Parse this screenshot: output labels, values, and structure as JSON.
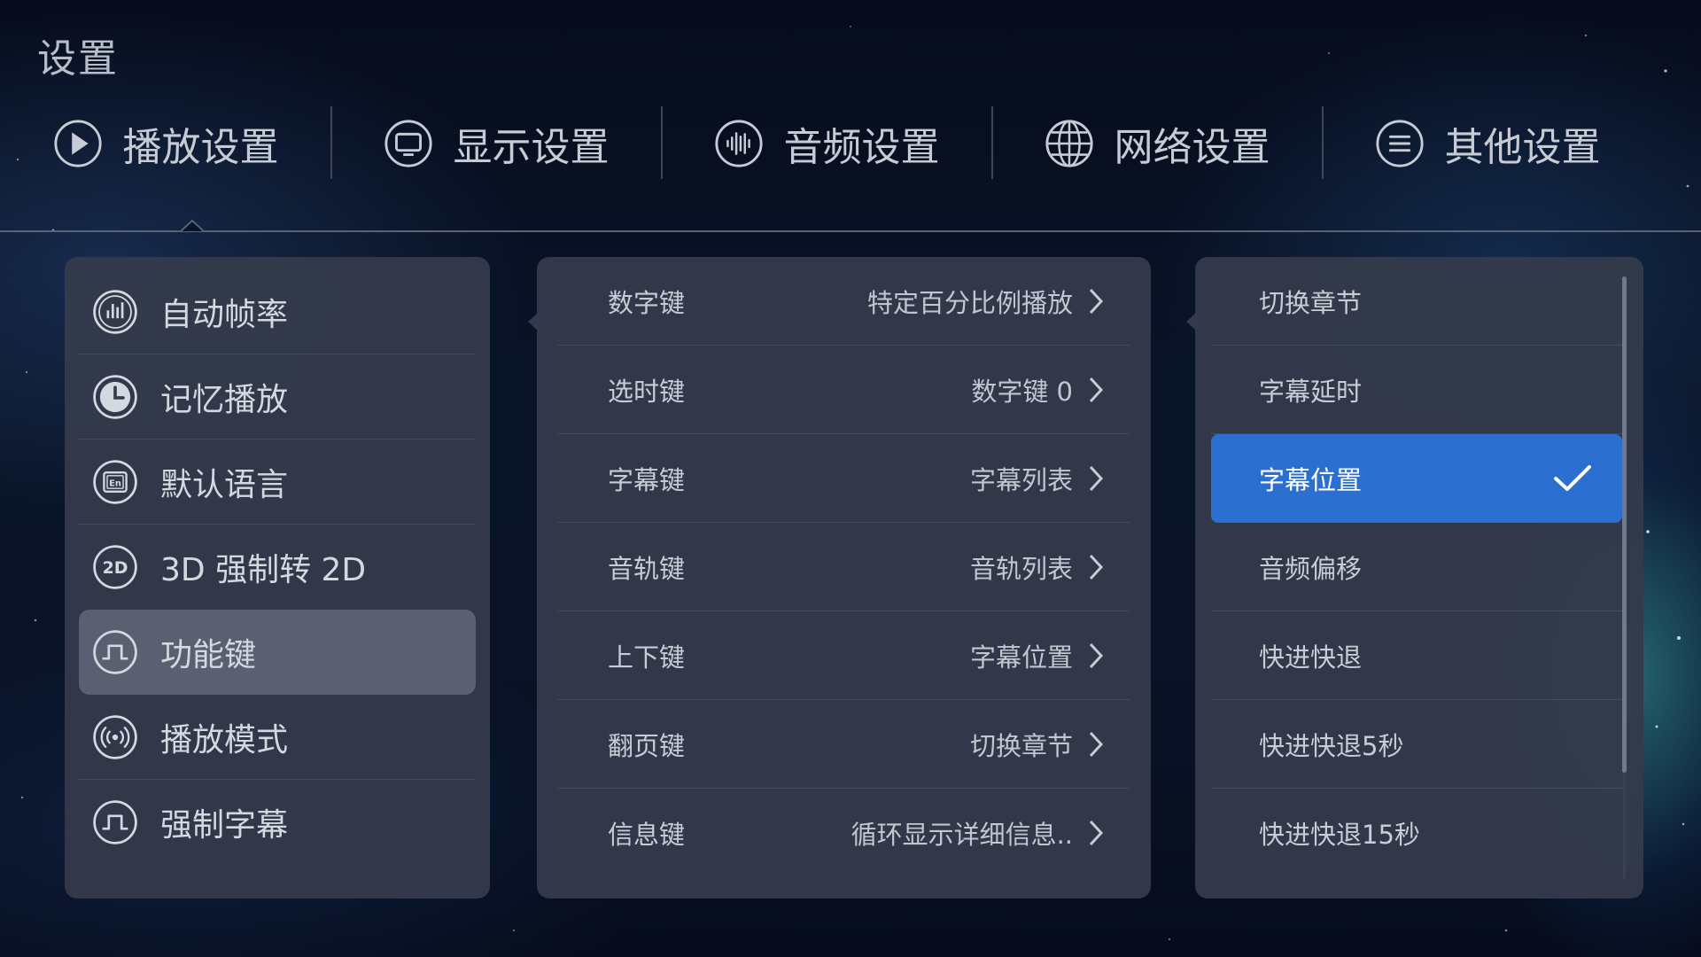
{
  "page": {
    "title": "设置"
  },
  "tabs": [
    {
      "label": "播放设置",
      "icon": "play-icon"
    },
    {
      "label": "显示设置",
      "icon": "monitor-icon"
    },
    {
      "label": "音频设置",
      "icon": "audio-wave-icon"
    },
    {
      "label": "网络设置",
      "icon": "globe-icon"
    },
    {
      "label": "其他设置",
      "icon": "menu-lines-icon"
    }
  ],
  "active_tab": "播放设置",
  "playback_menu": {
    "items": [
      {
        "label": "自动帧率",
        "icon": "bar-chart-icon"
      },
      {
        "label": "记忆播放",
        "icon": "clock-icon"
      },
      {
        "label": "默认语言",
        "icon": "language-en-icon"
      },
      {
        "label": "3D 强制转 2D",
        "icon": "2d-icon"
      },
      {
        "label": "功能键",
        "icon": "function-key-icon"
      },
      {
        "label": "播放模式",
        "icon": "broadcast-icon"
      },
      {
        "label": "强制字幕",
        "icon": "function-key-icon"
      }
    ],
    "selected": "功能键"
  },
  "function_keys": {
    "rows": [
      {
        "key": "数字键",
        "value": "特定百分比例播放"
      },
      {
        "key": "选时键",
        "value": "数字键 0"
      },
      {
        "key": "字幕键",
        "value": "字幕列表"
      },
      {
        "key": "音轨键",
        "value": "音轨列表"
      },
      {
        "key": "上下键",
        "value": "字幕位置"
      },
      {
        "key": "翻页键",
        "value": "切换章节"
      },
      {
        "key": "信息键",
        "value": "循环显示详细信息.."
      }
    ]
  },
  "options": {
    "items": [
      "切换章节",
      "字幕延时",
      "字幕位置",
      "音频偏移",
      "快进快退",
      "快进快退5秒",
      "快进快退15秒"
    ],
    "selected": "字幕位置"
  },
  "colors": {
    "accent": "#2b6fd1",
    "panel": "#343a4b",
    "selected_row": "#5a6071"
  }
}
